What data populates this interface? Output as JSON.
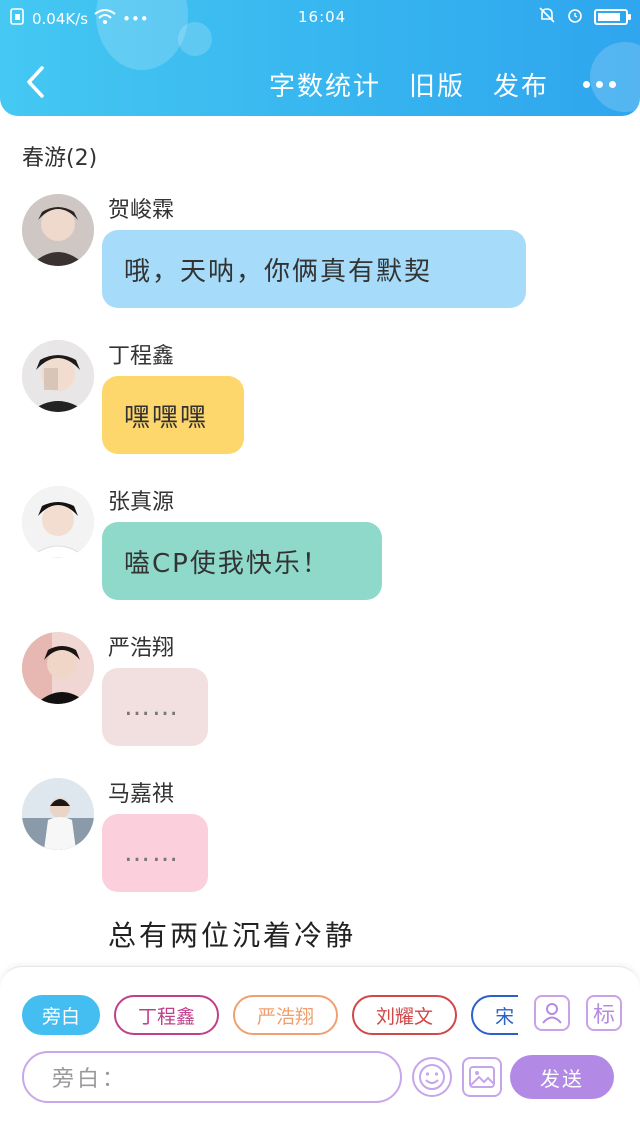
{
  "status_bar": {
    "speed": "0.04K/s",
    "more": "•••",
    "time": "16:04"
  },
  "nav": {
    "actions": [
      "字数统计",
      "旧版",
      "发布"
    ]
  },
  "group": {
    "title": "春游(2)"
  },
  "messages": [
    {
      "sender": "贺峻霖",
      "text": "哦，天呐，你俩真有默契",
      "bubble_color": "#a6dcf9"
    },
    {
      "sender": "丁程鑫",
      "text": "嘿嘿嘿",
      "bubble_color": "#fdd66c"
    },
    {
      "sender": "张真源",
      "text": "嗑CP使我快乐！",
      "bubble_color": "#8fd9cb"
    },
    {
      "sender": "严浩翔",
      "text": "……",
      "bubble_color": "#f2dfe0"
    },
    {
      "sender": "马嘉祺",
      "text": "……",
      "bubble_color": "#fbcfdc"
    }
  ],
  "narration": "总有两位沉着冷静",
  "composer": {
    "chips": [
      {
        "label": "旁白",
        "color": "#44bdf0"
      },
      {
        "label": "丁程鑫",
        "color": "#c0408a"
      },
      {
        "label": "严浩翔",
        "color": "#f0a070"
      },
      {
        "label": "刘耀文",
        "color": "#d04848"
      },
      {
        "label": "宋",
        "color": "#2a62c8"
      }
    ],
    "tag_button": "标",
    "placeholder": "旁白：",
    "send_label": "发送"
  },
  "colors": {
    "header": "#35b3ef",
    "accent_purple": "#b28ae6"
  }
}
